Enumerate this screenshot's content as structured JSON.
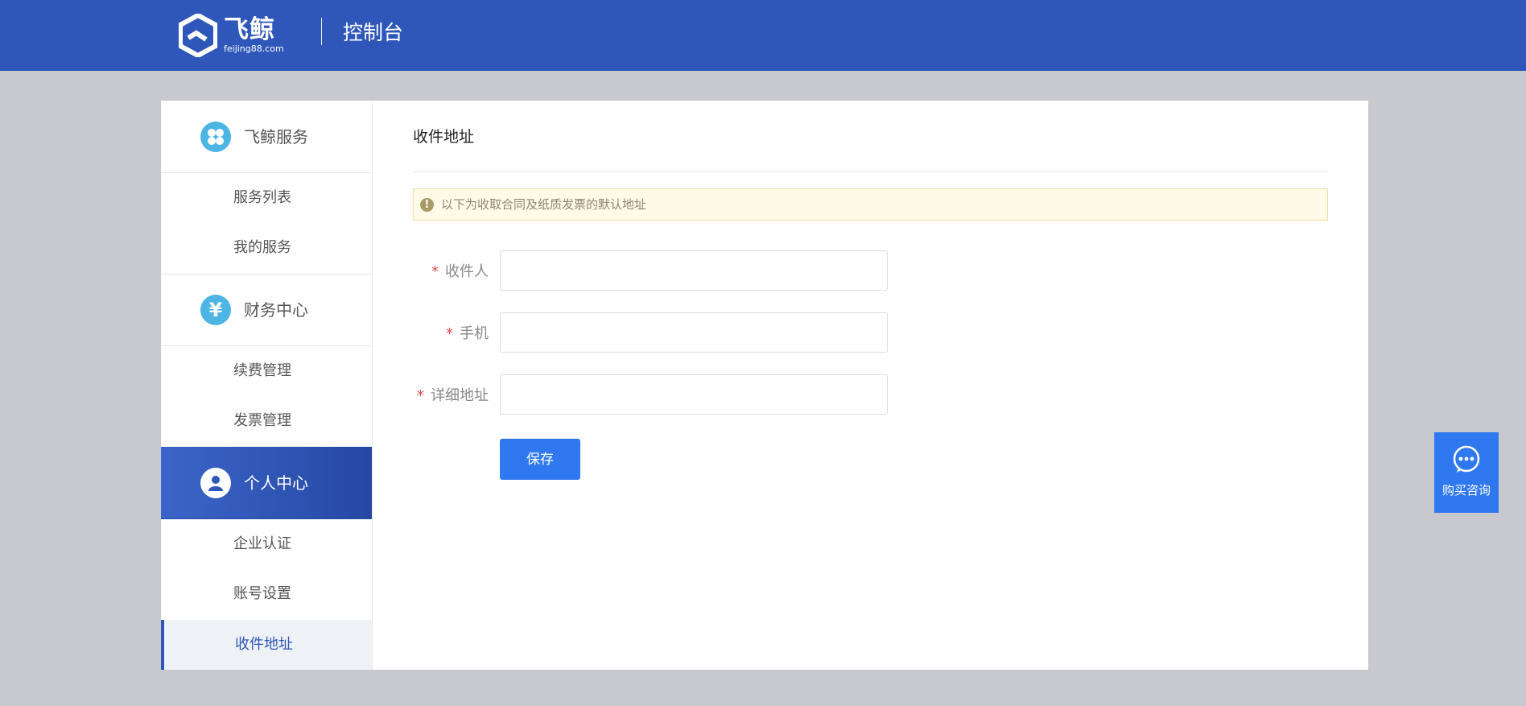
{
  "header": {
    "logo_text": "飞鲸",
    "logo_domain": "feijing88.com",
    "title": "控制台"
  },
  "sidebar": {
    "groups": [
      {
        "label": "飞鲸服务",
        "icon": "clover-icon",
        "items": [
          "服务列表",
          "我的服务"
        ]
      },
      {
        "label": "财务中心",
        "icon": "yen-icon",
        "items": [
          "续费管理",
          "发票管理"
        ]
      },
      {
        "label": "个人中心",
        "icon": "user-icon",
        "items": [
          "企业认证",
          "账号设置",
          "收件地址"
        ]
      }
    ],
    "active_group": "个人中心",
    "selected_item": "收件地址"
  },
  "main": {
    "title": "收件地址",
    "notice": {
      "icon": "exclamation-icon",
      "text": "以下为收取合同及纸质发票的默认地址"
    },
    "form": {
      "required_mark": "*",
      "fields": [
        {
          "label": "收件人",
          "value": "",
          "placeholder": ""
        },
        {
          "label": "手机",
          "value": "",
          "placeholder": ""
        },
        {
          "label": "详细地址",
          "value": "",
          "placeholder": ""
        }
      ],
      "submit_label": "保存"
    }
  },
  "float_widget": {
    "icon": "chat-bubble-icon",
    "label": "购买咨询"
  },
  "colors": {
    "header_bg": "#2f57b9",
    "page_bg": "#c8c9ce",
    "primary_button": "#2f78f0",
    "required_star": "#e24b4b",
    "notice_bg": "#fffbe8",
    "group_icon_bg": "#4db5e3"
  }
}
